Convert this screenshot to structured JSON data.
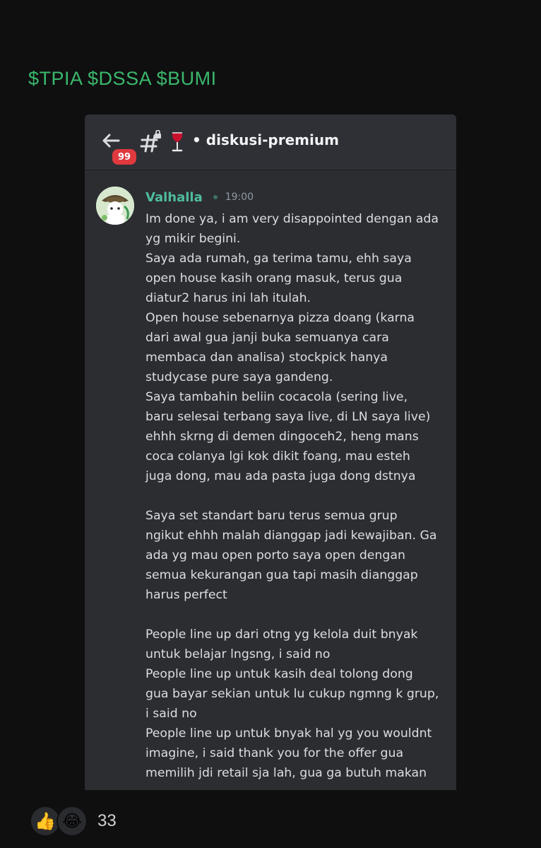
{
  "post": {
    "tickers": "$TPIA $DSSA $BUMI",
    "reaction_count": "33",
    "reactions": [
      "thumbs-up",
      "tears-of-joy"
    ]
  },
  "header": {
    "badge_count": "99",
    "channel_name": "• diskusi-premium",
    "icons": [
      "back-arrow-icon",
      "locked-hash-icon",
      "wine-glass-icon"
    ]
  },
  "message": {
    "username": "Valhalla",
    "timestamp": "19:00",
    "lines": [
      "Im done ya, i am very disappointed dengan ada",
      "yg mikir begini.",
      "Saya ada rumah, ga terima tamu, ehh saya",
      "open house kasih orang masuk, terus gua",
      "diatur2 harus ini lah itulah.",
      "Open house sebenarnya pizza doang (karna",
      "dari awal gua janji buka semuanya cara",
      "membaca dan analisa) stockpick hanya",
      "studycase pure saya gandeng.",
      "Saya tambahin beliin cocacola (sering live,",
      "baru selesai terbang saya live, di LN saya live)",
      "ehhh skrng di demen dingoceh2, heng mans",
      "coca colanya lgi kok dikit foang, mau esteh",
      "juga dong, mau ada pasta juga dong dstnya",
      "",
      "Saya set standart baru terus semua grup",
      "ngikut ehhh malah dianggap jadi kewajiban. Ga",
      "ada yg mau open porto saya open dengan",
      "semua kekurangan gua tapi masih dianggap",
      "harus perfect",
      "",
      "People line up dari otng yg kelola duit bnyak",
      "untuk belajar lngsng, i said no",
      "People line up untuk kasih deal tolong dong",
      "gua bayar sekian untuk lu cukup ngmng k grup,",
      "i said no",
      "People line up untuk bnyak hal yg you wouldnt",
      "imagine, i said thank you for the offer gua",
      "memilih  jdi retail sja lah, gua ga butuh makan"
    ]
  },
  "colors": {
    "tickers": "#3bb86c",
    "username": "#4fbca0",
    "badge": "#e0393e",
    "card_bg": "#2b2d31"
  }
}
